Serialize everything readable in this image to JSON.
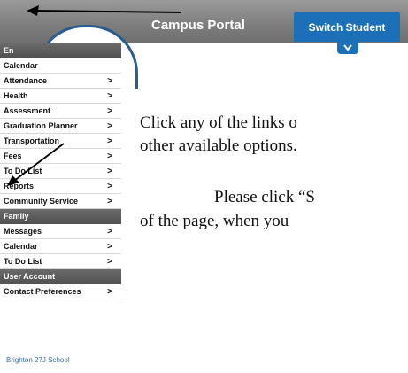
{
  "header": {
    "title": "Campus Portal",
    "switch_label": "Switch Student"
  },
  "sidebar": {
    "section_student": "En",
    "calendar_top": "Calendar",
    "student_items": [
      {
        "label": "Attendance"
      },
      {
        "label": "Health"
      },
      {
        "label": "Assessment"
      },
      {
        "label": "Graduation Planner"
      },
      {
        "label": "Transportation"
      },
      {
        "label": "Fees"
      },
      {
        "label": "To Do List"
      },
      {
        "label": "Reports"
      },
      {
        "label": "Community Service"
      }
    ],
    "section_family": "Family",
    "family_items": [
      {
        "label": "Messages"
      },
      {
        "label": "Calendar"
      },
      {
        "label": "To Do List"
      }
    ],
    "section_account": "User Account",
    "account_items": [
      {
        "label": "Contact Preferences"
      }
    ],
    "footer": "Brighton 27J School",
    "chevron": ">"
  },
  "main": {
    "line1": "Click any of the links o",
    "line2": "other available options.",
    "line3": "Please click “S",
    "line4": "of the page, when you"
  },
  "icons": {
    "chevron_down": "chevron-down-icon",
    "arrow_left": "arrow-left-annotation",
    "arrow_down_left": "arrow-down-left-annotation"
  },
  "colors": {
    "switch_blue": "#1b70b7",
    "header_gray": "#7d7d7d",
    "section_gray": "#505050"
  }
}
